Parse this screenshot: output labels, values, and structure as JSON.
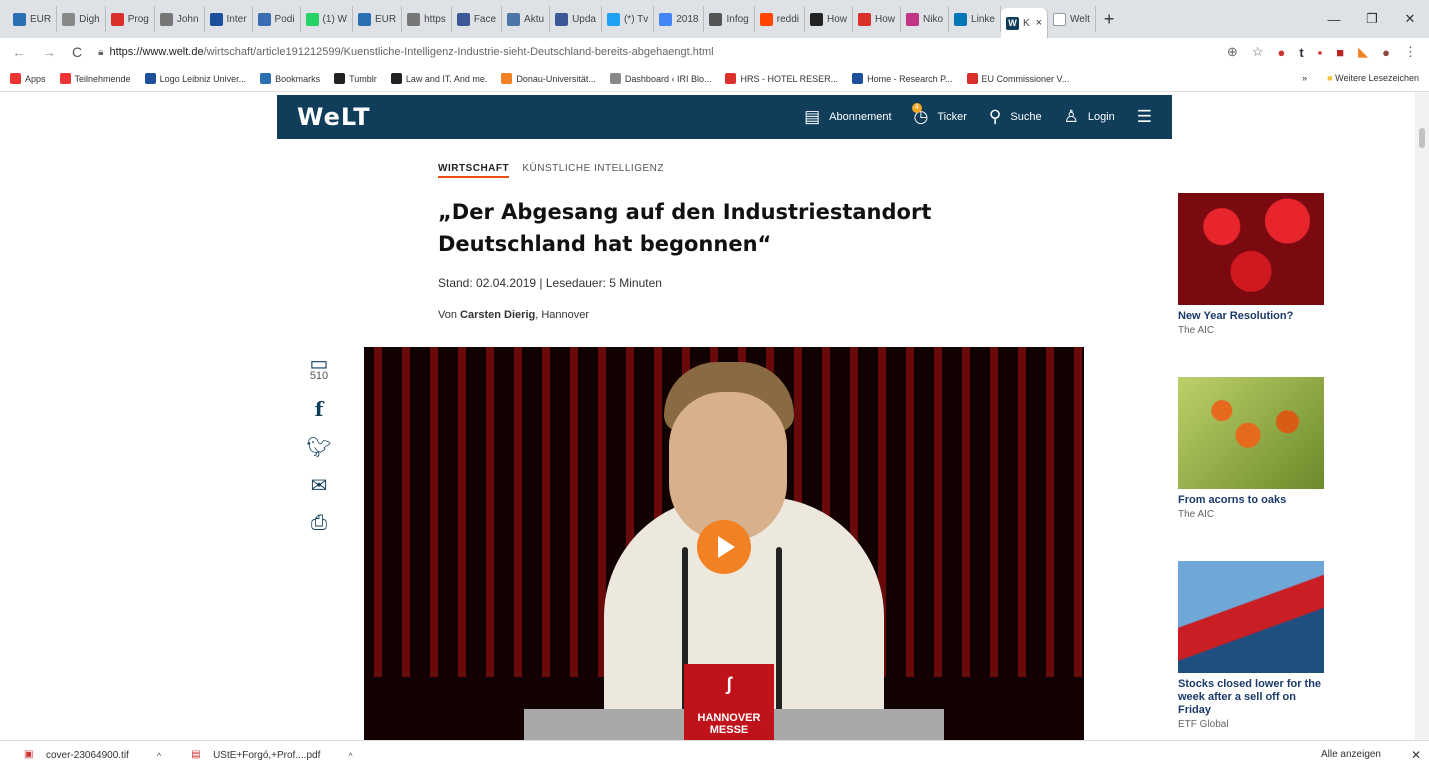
{
  "browser": {
    "tabs": [
      {
        "label": "EUR",
        "color": "#2a6fb0"
      },
      {
        "label": "Digh",
        "color": "#888888"
      },
      {
        "label": "Prog",
        "color": "#d9302c"
      },
      {
        "label": "John",
        "color": "#777777"
      },
      {
        "label": "Inter",
        "color": "#1b4f9c"
      },
      {
        "label": "Podi",
        "color": "#3b6db3"
      },
      {
        "label": "(1) W",
        "color": "#25d366"
      },
      {
        "label": "EUR",
        "color": "#2a6fb0"
      },
      {
        "label": "https",
        "color": "#777777"
      },
      {
        "label": "Face",
        "color": "#3b5998"
      },
      {
        "label": "Aktu",
        "color": "#4a76a8"
      },
      {
        "label": "Upda",
        "color": "#3b5998"
      },
      {
        "label": "(*) Tv",
        "color": "#1da1f2"
      },
      {
        "label": "2018",
        "color": "#4285f4"
      },
      {
        "label": "Infog",
        "color": "#555555"
      },
      {
        "label": "reddi",
        "color": "#ff4500"
      },
      {
        "label": "How",
        "color": "#222222"
      },
      {
        "label": "How",
        "color": "#d9302c"
      },
      {
        "label": "Niko",
        "color": "#c13584"
      },
      {
        "label": "Linke",
        "color": "#0077b5"
      }
    ],
    "active_tab": {
      "label": "K",
      "icon": "W"
    },
    "after_tab": {
      "label": "Welt"
    },
    "url_domain": "https://www.welt.de",
    "url_path": "/wirtschaft/article191212599/Kuenstliche-Intelligenz-Industrie-sieht-Deutschland-bereits-abgehaengt.html",
    "bookmarks": [
      {
        "label": "Apps",
        "color": "#e33"
      },
      {
        "label": "Teilnehmende",
        "color": "#e33"
      },
      {
        "label": "Logo Leibniz Univer...",
        "color": "#1b4f9c"
      },
      {
        "label": "Bookmarks",
        "color": "#2a6fb0"
      },
      {
        "label": "Tumblr",
        "color": "#222"
      },
      {
        "label": "Law and IT. And me.",
        "color": "#222"
      },
      {
        "label": "Donau-Universität...",
        "color": "#f28123"
      },
      {
        "label": "Dashboard ‹ IRI Blo...",
        "color": "#888"
      },
      {
        "label": "HRS - HOTEL RESER...",
        "color": "#d9302c"
      },
      {
        "label": "Home - Research P...",
        "color": "#1b4f9c"
      },
      {
        "label": "EU Commissioner V...",
        "color": "#d9302c"
      }
    ],
    "bookmarks_more": "»",
    "bookmarks_other": "Weitere Lesezeichen"
  },
  "site": {
    "logo": "WeLT",
    "nav": {
      "subscription": "Abonnement",
      "ticker": "Ticker",
      "ticker_badge": "4",
      "search": "Suche",
      "login": "Login"
    }
  },
  "article": {
    "category": "WIRTSCHAFT",
    "topic": "KÜNSTLICHE INTELLIGENZ",
    "title": "„Der Abgesang auf den Industriestandort Deutschland hat begonnen“",
    "meta": "Stand: 02.04.2019 | Lesedauer: 5 Minuten",
    "author_prefix": "Von ",
    "author": "Carsten Dierig",
    "author_suffix": ", Hannover",
    "comment_count": "510",
    "video_logo_text": "HANNOVER MESSE"
  },
  "ads": [
    {
      "headline": "New Year Resolution?",
      "source": "The AIC",
      "color": "#b3121a"
    },
    {
      "headline": "From acorns to oaks",
      "source": "The AIC",
      "color": "#6b8a2a"
    },
    {
      "headline": "Stocks closed lower for the week after a sell off on Friday",
      "source": "ETF Global",
      "color": "#3a6ea5"
    }
  ],
  "downloads": [
    {
      "name": "cover-23064900.tif"
    },
    {
      "name": "UStE+Forgó,+Prof....pdf"
    }
  ],
  "downloads_show_all": "Alle anzeigen"
}
